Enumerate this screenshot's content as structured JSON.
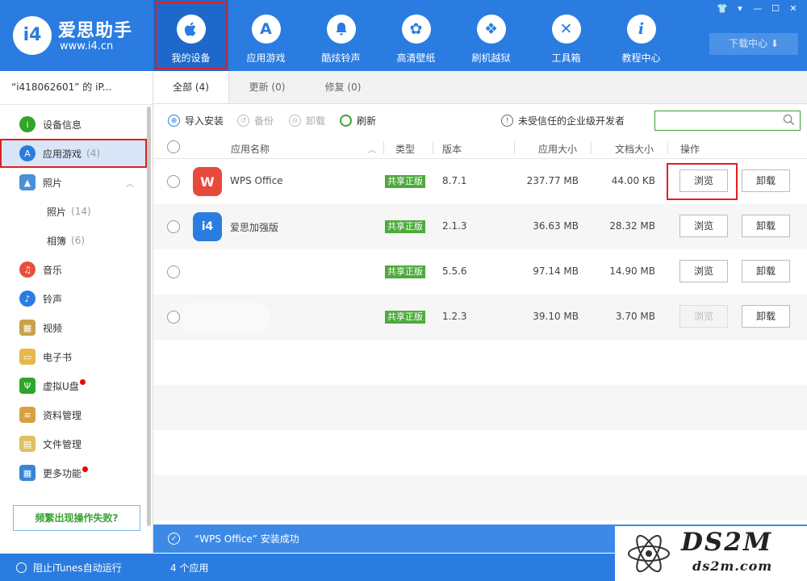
{
  "header": {
    "logo_name": "爱思助手",
    "logo_url": "www.i4.cn",
    "logo_mark": "i4",
    "nav": [
      {
        "label": "我的设备",
        "icon": "apple-icon",
        "glyph": ""
      },
      {
        "label": "应用游戏",
        "icon": "app-store-icon",
        "glyph": "A"
      },
      {
        "label": "酷炫铃声",
        "icon": "bell-icon",
        "glyph": "🔔"
      },
      {
        "label": "高清壁纸",
        "icon": "flower-icon",
        "glyph": "✿"
      },
      {
        "label": "刷机越狱",
        "icon": "box-icon",
        "glyph": "❖"
      },
      {
        "label": "工具箱",
        "icon": "tools-icon",
        "glyph": "✕"
      },
      {
        "label": "教程中心",
        "icon": "info-icon",
        "glyph": "i"
      }
    ],
    "download_label": "下载中心 ⬇",
    "window_controls": [
      "👕",
      "▾",
      "—",
      "☐",
      "✕"
    ]
  },
  "sidebar": {
    "device_name": "“i418062601” 的 iP...",
    "items": [
      {
        "label": "设备信息",
        "count": "",
        "icon": "info-circle-icon",
        "color": "#2fa52a",
        "glyph": "i"
      },
      {
        "label": "应用游戏",
        "count": "(4)",
        "icon": "app-store-icon",
        "color": "#2a7ce0",
        "glyph": "A"
      },
      {
        "label": "照片",
        "count": "",
        "icon": "photo-icon",
        "color": "#4a90d9",
        "glyph": "▲"
      },
      {
        "label": "照片",
        "count": "(14)",
        "icon": "",
        "color": "",
        "glyph": ""
      },
      {
        "label": "相簿",
        "count": "(6)",
        "icon": "",
        "color": "",
        "glyph": ""
      },
      {
        "label": "音乐",
        "count": "",
        "icon": "music-icon",
        "color": "#e8503a",
        "glyph": "♫"
      },
      {
        "label": "铃声",
        "count": "",
        "icon": "bell-icon",
        "color": "#2a7ce0",
        "glyph": "♪"
      },
      {
        "label": "视频",
        "count": "",
        "icon": "film-icon",
        "color": "#c8a24a",
        "glyph": "▦"
      },
      {
        "label": "电子书",
        "count": "",
        "icon": "book-icon",
        "color": "#e8b84a",
        "glyph": "▭"
      },
      {
        "label": "虚拟U盘",
        "count": "",
        "icon": "usb-icon",
        "color": "#2fa52a",
        "glyph": "Ψ"
      },
      {
        "label": "资料管理",
        "count": "",
        "icon": "contacts-icon",
        "color": "#d8a040",
        "glyph": "≡"
      },
      {
        "label": "文件管理",
        "count": "",
        "icon": "file-icon",
        "color": "#e0c060",
        "glyph": "▤"
      },
      {
        "label": "更多功能",
        "count": "",
        "icon": "grid-icon",
        "color": "#3a86d6",
        "glyph": "▦"
      }
    ],
    "help_label": "频繁出现操作失败?"
  },
  "tabs": [
    {
      "label": "全部 (4)"
    },
    {
      "label": "更新 (0)"
    },
    {
      "label": "修复 (0)"
    }
  ],
  "toolbar": {
    "import": "导入安装",
    "backup": "备份",
    "uninstall": "卸载",
    "refresh": "刷新",
    "warning": "未受信任的企业级开发者",
    "search_placeholder": ""
  },
  "table": {
    "headers": {
      "name": "应用名称",
      "type": "类型",
      "version": "版本",
      "app_size": "应用大小",
      "doc_size": "文档大小",
      "ops": "操作"
    },
    "rows": [
      {
        "name": "WPS Office",
        "icon": "wps-icon",
        "icon_color": "#e8493b",
        "icon_glyph": "W",
        "type": "共享正版",
        "version": "8.7.1",
        "app_size": "237.77 MB",
        "doc_size": "44.00 KB",
        "browse": "浏览",
        "uninstall": "卸载",
        "browse_enabled": true
      },
      {
        "name": "爱思加强版",
        "icon": "i4-icon",
        "icon_color": "#2a7ce0",
        "icon_glyph": "i4",
        "type": "共享正版",
        "version": "2.1.3",
        "app_size": "36.63 MB",
        "doc_size": "28.32 MB",
        "browse": "浏览",
        "uninstall": "卸载",
        "browse_enabled": true
      },
      {
        "name": "",
        "icon": "",
        "icon_color": "",
        "icon_glyph": "",
        "type": "共享正版",
        "version": "5.5.6",
        "app_size": "97.14 MB",
        "doc_size": "14.90 MB",
        "browse": "浏览",
        "uninstall": "卸载",
        "browse_enabled": true
      },
      {
        "name": "",
        "icon": "",
        "icon_color": "",
        "icon_glyph": "",
        "type": "共享正版",
        "version": "1.2.3",
        "app_size": "39.10 MB",
        "doc_size": "3.70 MB",
        "browse": "浏览",
        "uninstall": "卸载",
        "browse_enabled": false
      }
    ]
  },
  "status_message": "“WPS Office” 安装成功",
  "footer": {
    "itunes_label": "阻止iTunes自动运行",
    "app_count": "4 个应用"
  },
  "watermark": {
    "big": "DS2M",
    "small": "ds2m.com"
  }
}
